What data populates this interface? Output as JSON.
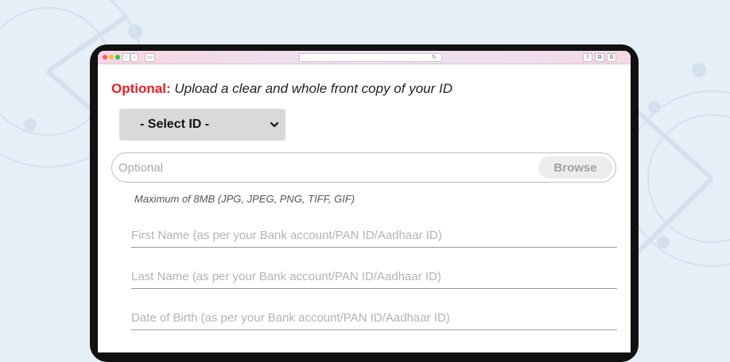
{
  "browser": {
    "back_icon": "chevron-left-icon",
    "sidebar_icon": "sidebar-icon",
    "reload_icon": "reload-icon",
    "share_icon": "share-icon",
    "tabs_icon": "tabs-icon",
    "settings_icon": "gear-icon"
  },
  "form": {
    "heading": {
      "label": "Optional:",
      "text": "Upload a clear and whole front copy of your ID"
    },
    "id_select": {
      "selected": "- Select ID -"
    },
    "upload": {
      "placeholder": "Optional",
      "browse_label": "Browse"
    },
    "hint": "Maximum of 8MB (JPG, JPEG, PNG, TIFF, GIF)",
    "first_name": {
      "placeholder": "First Name (as per your Bank account/PAN ID/Aadhaar ID)"
    },
    "last_name": {
      "placeholder": "Last Name (as per your Bank account/PAN ID/Aadhaar ID)"
    },
    "dob": {
      "placeholder": "Date of Birth (as per your Bank account/PAN ID/Aadhaar ID)"
    }
  },
  "colors": {
    "accent_red": "#ec1c24",
    "background": "#e6eef7",
    "select_bg": "#d9d9d9"
  }
}
